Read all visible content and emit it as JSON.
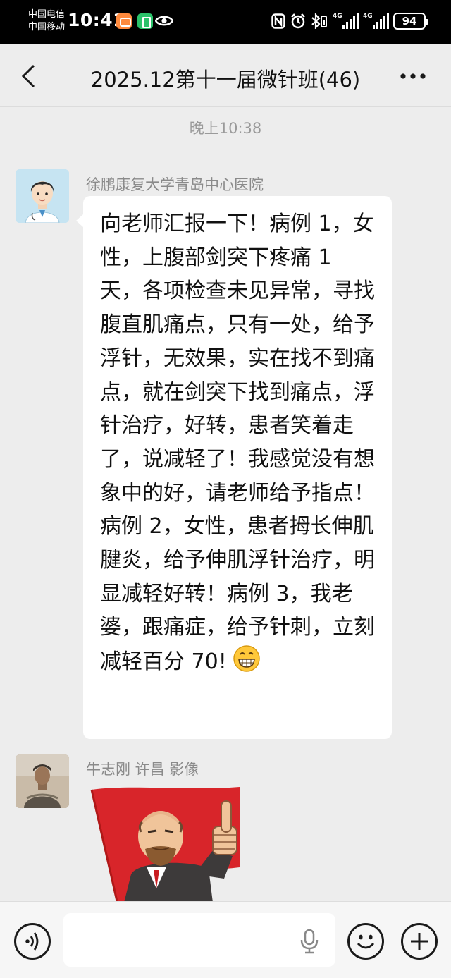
{
  "status_bar": {
    "carrier_1": "中国电信",
    "carrier_2": "中国移动",
    "time": "10:41",
    "network_1": "4G",
    "network_2": "4G",
    "battery": "94",
    "icons": [
      "app-notification-icon",
      "app-timer-icon",
      "eye-icon",
      "nfc-icon",
      "alarm-icon",
      "bluetooth-icon",
      "signal-icon",
      "battery-icon"
    ]
  },
  "header": {
    "title": "2025.12第十一届微针班(46)",
    "back_icon": "chevron-left-icon",
    "more_icon": "more-dots-icon"
  },
  "chat": {
    "timestamp": "晚上10:38",
    "messages": [
      {
        "sender": "徐鹏康复大学青岛中心医院",
        "avatar": "doctor-cartoon-avatar",
        "text": "向老师汇报一下！病例 1，女性，上腹部剑突下疼痛 1 天，各项检查未见异常，寻找腹直肌痛点，只有一处，给予浮针，无效果，实在找不到痛点，就在剑突下找到痛点，浮针治疗，好转，患者笑着走了，说减轻了！我感觉没有想象中的好，请老师给予指点！病例 2，女性，患者拇长伸肌腱炎，给予伸肌浮针治疗，明显减轻好转！病例 3，我老婆，跟痛症，给予针刺，立刻减轻百分 70!",
        "emoji": "grinning-face-emoji"
      },
      {
        "sender": "牛志刚  许昌 影像",
        "avatar": "person-photo-avatar",
        "sticker": "thumbs-up-red-flag-sticker"
      }
    ]
  },
  "input_bar": {
    "voice_icon": "voice-mode-icon",
    "placeholder": "",
    "mic_icon": "microphone-icon",
    "emoji_icon": "emoji-icon",
    "plus_icon": "plus-icon"
  }
}
